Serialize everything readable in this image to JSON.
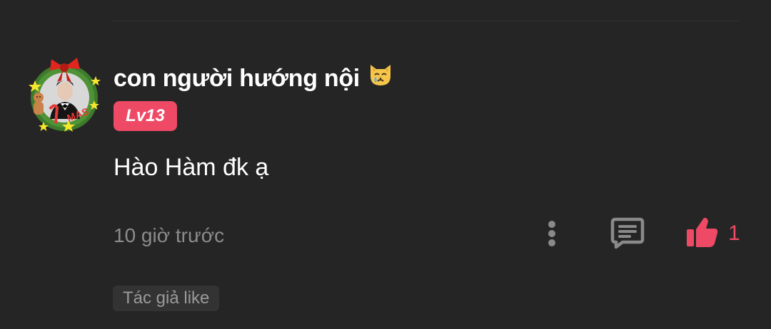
{
  "comment": {
    "username": "con người hướng nội",
    "username_emoji": "crying-cat-face",
    "level": "Lv13",
    "text": "Hào Hàm đk ạ",
    "timestamp": "10 giờ trước",
    "like_count": "1",
    "author_like_label": "Tác giả like"
  },
  "colors": {
    "background": "#252525",
    "accent": "#ee4a66",
    "muted_text": "#8c8c8c",
    "icon_gray": "#8a8a8a",
    "tag_bg": "#333333"
  },
  "icons": {
    "more": "more-vertical-icon",
    "reply": "comment-icon",
    "like": "thumbs-up-icon"
  }
}
